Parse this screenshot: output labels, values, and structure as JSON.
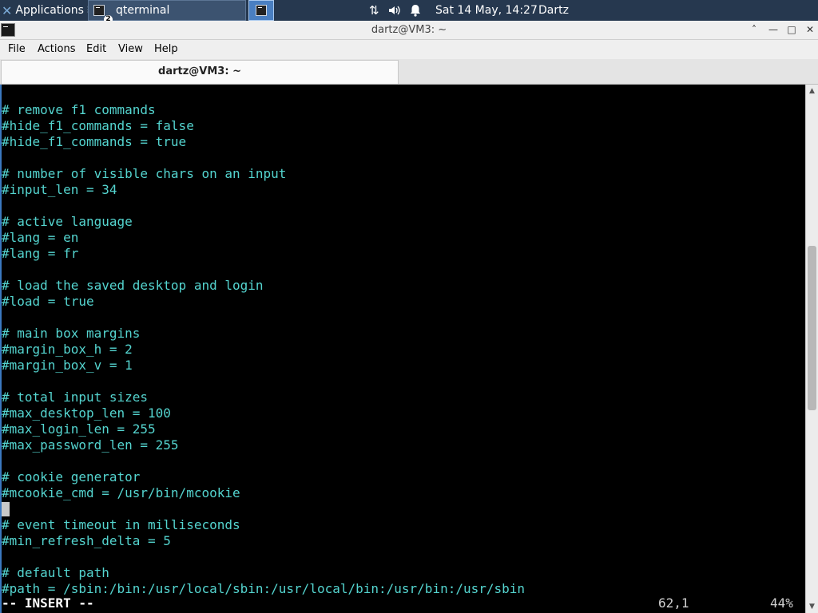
{
  "panel": {
    "apps_label": "Applications",
    "apps_sep": "⠿",
    "task_label": "qterminal",
    "task_badge": "2",
    "clock": "Sat 14 May, 14:27",
    "user": "Dartz",
    "icons": {
      "network": "network-arrows-icon",
      "volume": "volume-icon",
      "notifications": "bell-icon"
    }
  },
  "window": {
    "title": "dartz@VM3: ~",
    "buttons": {
      "shade": "˄",
      "minimize": "—",
      "maximize": "□",
      "close": "✕"
    }
  },
  "menubar": {
    "items": [
      "File",
      "Actions",
      "Edit",
      "View",
      "Help"
    ]
  },
  "tabs": [
    {
      "label": "dartz@VM3: ~"
    }
  ],
  "terminal": {
    "lines": [
      "# remove f1 commands",
      "#hide_f1_commands = false",
      "#hide_f1_commands = true",
      "",
      "# number of visible chars on an input",
      "#input_len = 34",
      "",
      "# active language",
      "#lang = en",
      "#lang = fr",
      "",
      "# load the saved desktop and login",
      "#load = true",
      "",
      "# main box margins",
      "#margin_box_h = 2",
      "#margin_box_v = 1",
      "",
      "# total input sizes",
      "#max_desktop_len = 100",
      "#max_login_len = 255",
      "#max_password_len = 255",
      "",
      "# cookie generator",
      "#mcookie_cmd = /usr/bin/mcookie",
      "",
      "# event timeout in milliseconds",
      "#min_refresh_delta = 5",
      "",
      "# default path",
      "#path = /sbin:/bin:/usr/local/sbin:/usr/local/bin:/usr/bin:/usr/sbin"
    ],
    "cursor_line_index": 25,
    "status": {
      "mode": "-- INSERT --",
      "position": "62,1",
      "percent": "44%"
    }
  },
  "scrollbar": {
    "up_icon": "▲",
    "down_icon": "▼",
    "position_fraction": 0.44,
    "visible_fraction": 0.33
  },
  "colors": {
    "text": "#54d4cf",
    "background": "#000000",
    "panel": "#26384f",
    "accent": "#3b78c0"
  }
}
